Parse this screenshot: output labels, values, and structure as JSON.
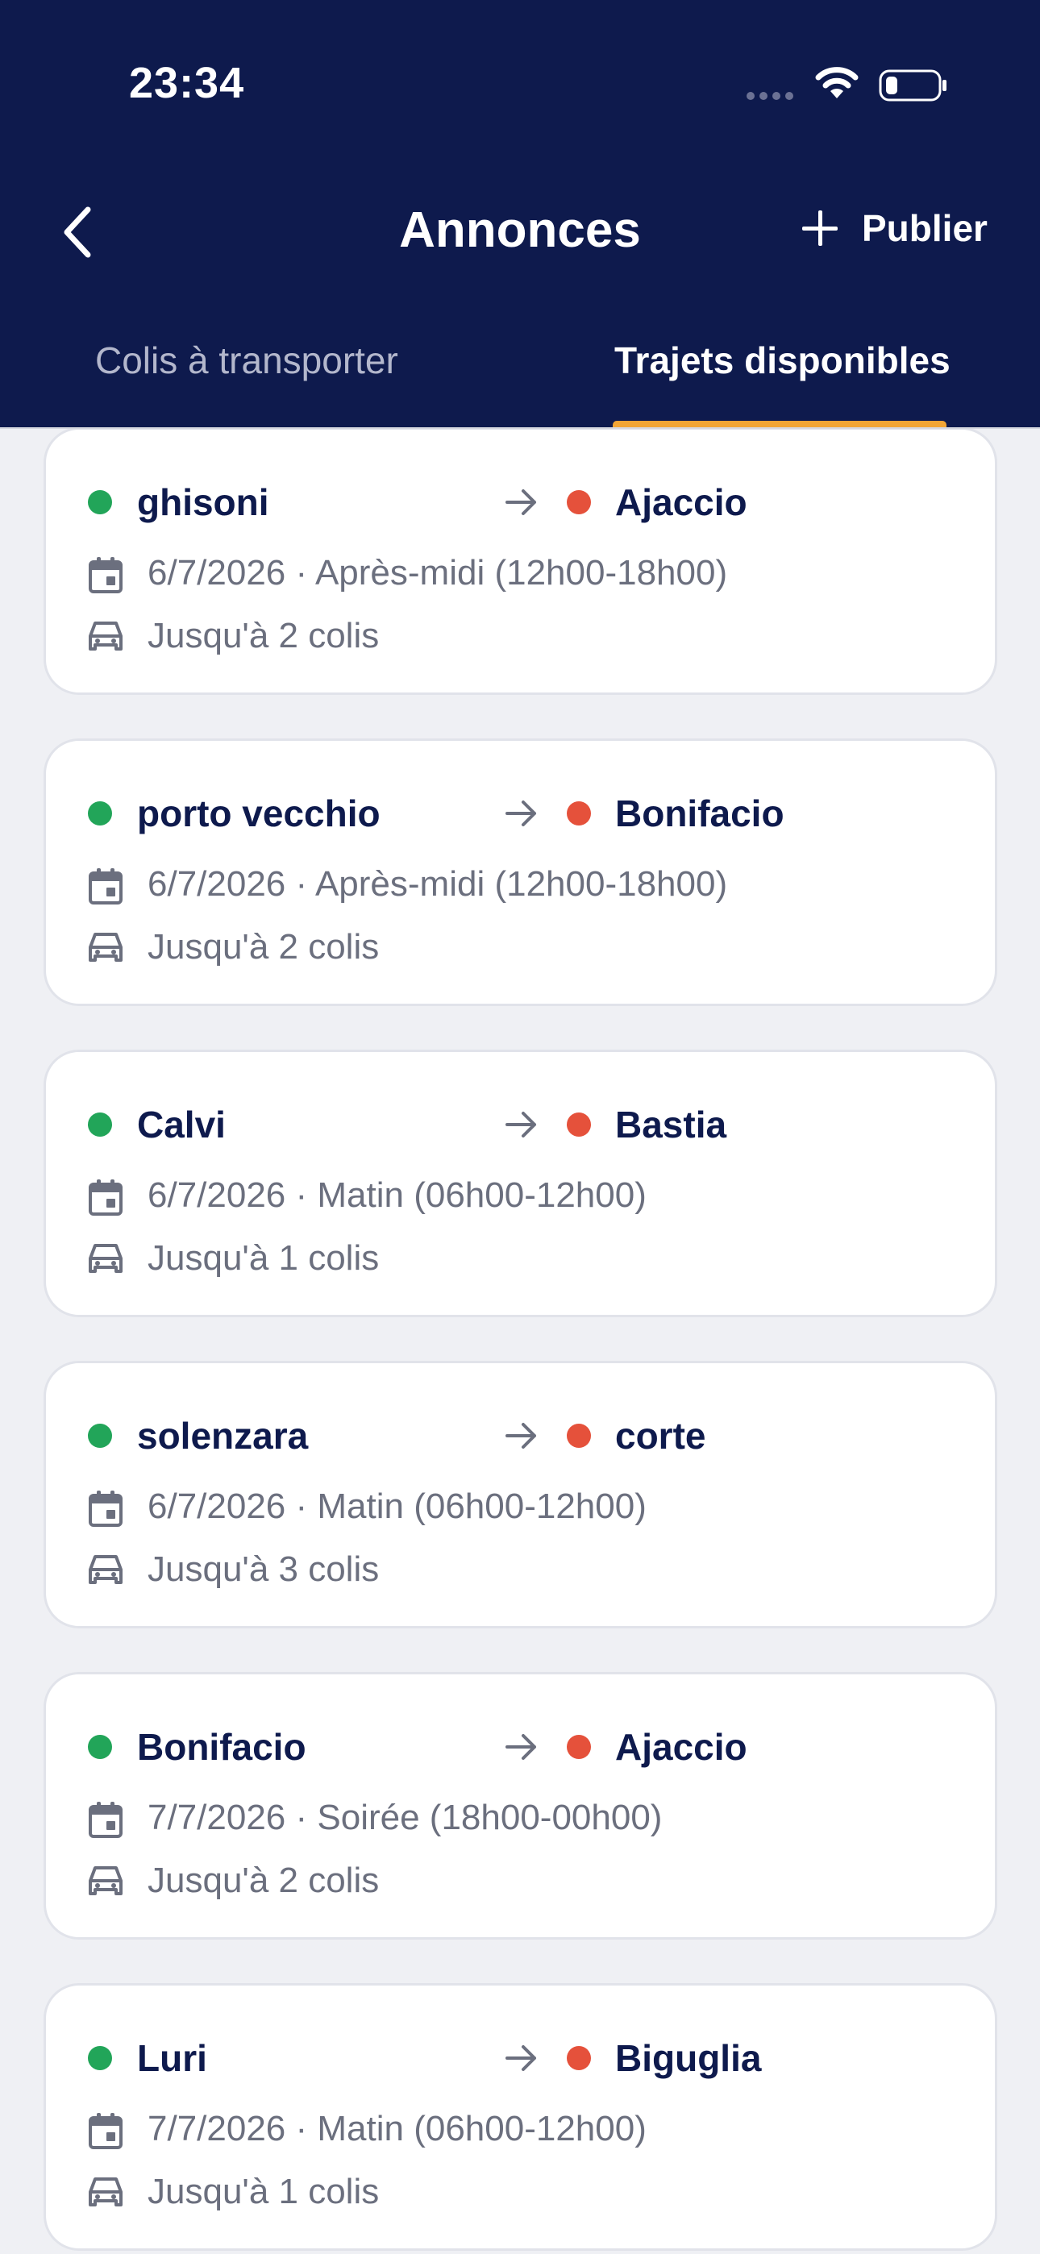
{
  "status_bar": {
    "time": "23:34"
  },
  "header": {
    "title": "Annonces",
    "publish_label": "Publier",
    "tabs": [
      {
        "label": "Colis à transporter",
        "active": false
      },
      {
        "label": "Trajets disponibles",
        "active": true
      }
    ]
  },
  "colors": {
    "header_bg": "#0E1A4D",
    "tab_indicator": "#F2A535",
    "origin_dot": "#22A559",
    "destination_dot": "#E5513B"
  },
  "trips": [
    {
      "from": "ghisoni",
      "to": "Ajaccio",
      "date": "6/7/2026 · Après-midi (12h00-18h00)",
      "capacity": "Jusqu'à 2 colis"
    },
    {
      "from": "porto vecchio",
      "to": "Bonifacio",
      "date": "6/7/2026 · Après-midi (12h00-18h00)",
      "capacity": "Jusqu'à 2 colis"
    },
    {
      "from": "Calvi",
      "to": "Bastia",
      "date": "6/7/2026 · Matin (06h00-12h00)",
      "capacity": "Jusqu'à 1 colis"
    },
    {
      "from": "solenzara",
      "to": "corte",
      "date": "6/7/2026 · Matin (06h00-12h00)",
      "capacity": "Jusqu'à 3 colis"
    },
    {
      "from": "Bonifacio",
      "to": "Ajaccio",
      "date": "7/7/2026 · Soirée (18h00-00h00)",
      "capacity": "Jusqu'à 2 colis"
    },
    {
      "from": "Luri",
      "to": "Biguglia",
      "date": "7/7/2026 · Matin (06h00-12h00)",
      "capacity": "Jusqu'à 1 colis"
    }
  ]
}
